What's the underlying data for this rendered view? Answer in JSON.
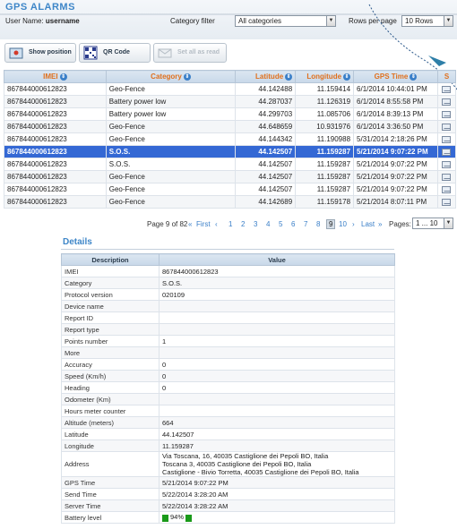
{
  "header": {
    "title": "GPS ALARMS",
    "user_label": "User Name:",
    "username": "username",
    "category_filter_label": "Category filter",
    "category_filter_value": "All categories",
    "rows_per_page_label": "Rows per page",
    "rows_per_page_value": "10 Rows"
  },
  "toolbar": {
    "show_position_label": "Show position",
    "qr_code_label": "QR Code",
    "set_all_read_label": "Set all as read"
  },
  "alarms": {
    "columns": [
      "IMEI",
      "Category",
      "Latitude",
      "Longitude",
      "GPS Time",
      "S"
    ],
    "rows": [
      {
        "imei": "867844000612823",
        "category": "Geo-Fence",
        "lat": "44.142488",
        "lon": "11.159414",
        "time": "6/1/2014 10:44:01 PM"
      },
      {
        "imei": "867844000612823",
        "category": "Battery power low",
        "lat": "44.287037",
        "lon": "11.126319",
        "time": "6/1/2014 8:55:58 PM"
      },
      {
        "imei": "867844000612823",
        "category": "Battery power low",
        "lat": "44.299703",
        "lon": "11.085706",
        "time": "6/1/2014 8:39:13 PM"
      },
      {
        "imei": "867844000612823",
        "category": "Geo-Fence",
        "lat": "44.648659",
        "lon": "10.931976",
        "time": "6/1/2014 3:36:50 PM"
      },
      {
        "imei": "867844000612823",
        "category": "Geo-Fence",
        "lat": "44.144342",
        "lon": "11.190988",
        "time": "5/31/2014 2:18:26 PM"
      },
      {
        "imei": "867844000612823",
        "category": "S.O.S.",
        "lat": "44.142507",
        "lon": "11.159287",
        "time": "5/21/2014 9:07:22 PM"
      },
      {
        "imei": "867844000612823",
        "category": "S.O.S.",
        "lat": "44.142507",
        "lon": "11.159287",
        "time": "5/21/2014 9:07:22 PM"
      },
      {
        "imei": "867844000612823",
        "category": "Geo-Fence",
        "lat": "44.142507",
        "lon": "11.159287",
        "time": "5/21/2014 9:07:22 PM"
      },
      {
        "imei": "867844000612823",
        "category": "Geo-Fence",
        "lat": "44.142507",
        "lon": "11.159287",
        "time": "5/21/2014 9:07:22 PM"
      },
      {
        "imei": "867844000612823",
        "category": "Geo-Fence",
        "lat": "44.142689",
        "lon": "11.159178",
        "time": "5/21/2014 8:07:11 PM"
      }
    ],
    "selected_row": 5
  },
  "pager": {
    "page_info": "Page 9 of 82",
    "first": "First",
    "last": "Last",
    "pages": [
      "1",
      "2",
      "3",
      "4",
      "5",
      "6",
      "7",
      "8",
      "9",
      "10"
    ],
    "current": "9",
    "pages_label": "Pages:",
    "pages_value": "1 ... 10"
  },
  "details": {
    "title": "Details",
    "col_description": "Description",
    "col_value": "Value",
    "rows": [
      {
        "k": "IMEI",
        "v": "867844000612823"
      },
      {
        "k": "Category",
        "v": "S.O.S."
      },
      {
        "k": "Protocol version",
        "v": "020109"
      },
      {
        "k": "Device name",
        "v": ""
      },
      {
        "k": "Report ID",
        "v": ""
      },
      {
        "k": "Report type",
        "v": ""
      },
      {
        "k": "Points number",
        "v": "1"
      },
      {
        "k": "More",
        "v": ""
      },
      {
        "k": "Accuracy",
        "v": "0"
      },
      {
        "k": "Speed (Km/h)",
        "v": "0"
      },
      {
        "k": "Heading",
        "v": "0"
      },
      {
        "k": "Odometer (Km)",
        "v": ""
      },
      {
        "k": "Hours meter counter",
        "v": ""
      },
      {
        "k": "Altitude (meters)",
        "v": "664"
      },
      {
        "k": "Latitude",
        "v": "44.142507"
      },
      {
        "k": "Longitude",
        "v": "11.159287"
      },
      {
        "k": "Address",
        "v": "Via Toscana, 16, 40035 Castiglione dei Pepoli BO, Italia\nToscana 3, 40035 Castiglione dei Pepoli BO, Italia\nCastiglione - Bivio Torretta, 40035 Castiglione dei Pepoli BO, Italia"
      },
      {
        "k": "GPS Time",
        "v": "5/21/2014 9:07:22 PM"
      },
      {
        "k": "Send Time",
        "v": "5/22/2014 3:28:20 AM"
      },
      {
        "k": "Server Time",
        "v": "5/22/2014 3:28:22 AM"
      },
      {
        "k": "Battery level",
        "v": "94%",
        "battery": true
      }
    ]
  },
  "colors": {
    "accent": "#3e86c8",
    "header_text": "#e0701d",
    "selected_row": "#3468d4",
    "battery": "#1a9a1a"
  }
}
